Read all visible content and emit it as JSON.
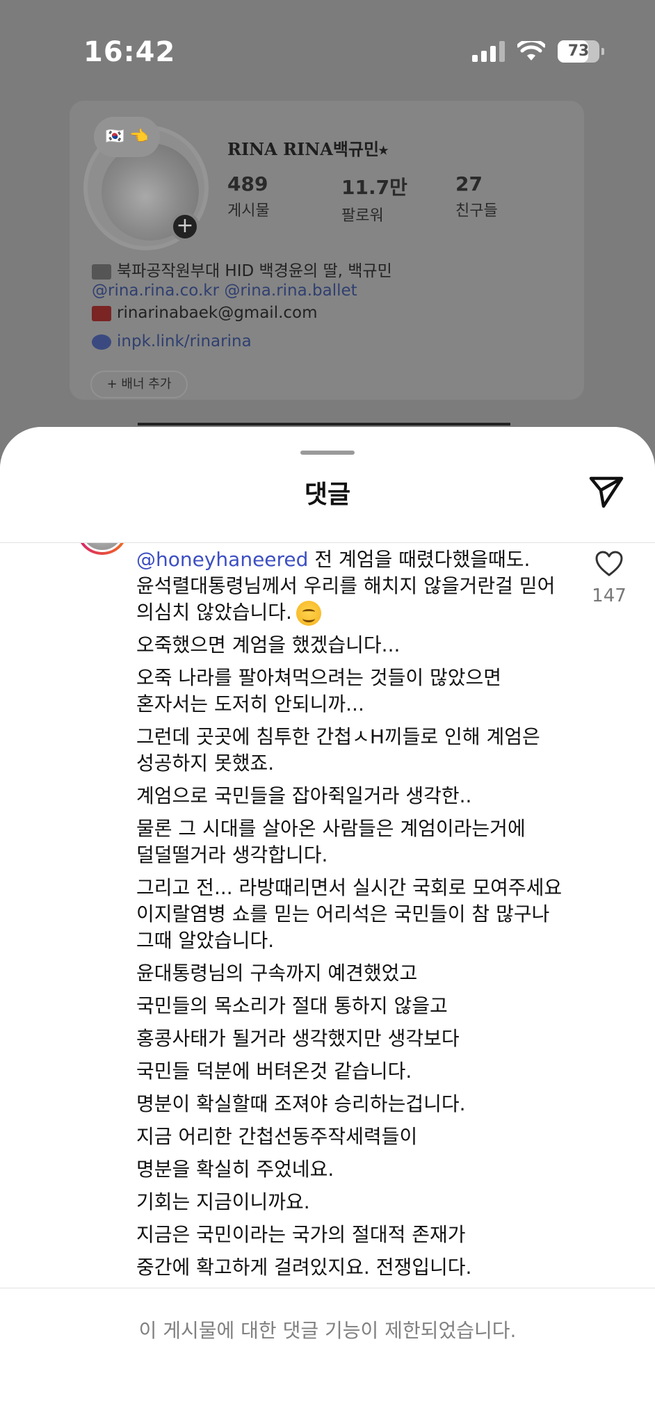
{
  "status_bar": {
    "time": "16:42",
    "battery": "73",
    "icons": [
      "cellular-signal-icon",
      "wifi-icon",
      "battery-icon"
    ]
  },
  "profile": {
    "name": "RINA RINA백규민⭑",
    "avatar_bubble": "🇰🇷 👈",
    "stats": [
      {
        "value": "489",
        "label": "게시물"
      },
      {
        "value": "11.7만",
        "label": "팔로워"
      },
      {
        "value": "27",
        "label": "친구들"
      }
    ],
    "bio_line": "북파공작원부대 HID 백경윤의 딸, 백규민",
    "accounts": "@rina.rina.co.kr @rina.rina.ballet",
    "email": "rinarinabaek@gmail.com",
    "link": "inpk.link/rinarina",
    "banner_button": "+ 배너 추가"
  },
  "sheet": {
    "title": "댓글"
  },
  "comment": {
    "mention": "@honeyhaneered",
    "first_line_rest": " 전 계엄을 때렸다했을때도. 윤석렬대통령님께서 우리를 해치지 않을거란걸 믿어 의심치 않았습니다.",
    "paragraphs": [
      "오죽했으면 계엄을 했겠습니다...",
      "오죽 나라를 팔아쳐먹으려는 것들이 많았으면 혼자서는 도저히 안되니까...",
      "그런데 곳곳에 침투한 간첩ㅅH끼들로 인해 계엄은 성공하지 못했죠.",
      "계엄으로 국민들을 잡아쥑일거라 생각한..",
      "물론 그 시대를 살아온 사람들은 계엄이라는거에 덜덜떨거라 생각합니다.",
      "그리고 전... 라방때리면서 실시간 국회로 모여주세요 이지랄염병 쇼를 믿는 어리석은 국민들이 참 많구나 그때 알았습니다.",
      "윤대통령님의 구속까지 예견했었고",
      "국민들의 목소리가 절대 통하지 않을고",
      "홍콩사태가 될거라 생각했지만 생각보다",
      "국민들 덕분에 버텨온것 같습니다.",
      "명분이 확실할때 조져야 승리하는겁니다.",
      "지금 어리한 간첩선동주작세력들이",
      "명분을 확실히 주었네요.",
      "기회는 지금이니까요.",
      "지금은 국민이라는 국가의 절대적 존재가",
      "중간에 확고하게 걸려있지요. 전쟁입니다."
    ],
    "like_count": "147"
  },
  "footer": {
    "notice": "이 게시물에 대한 댓글 기능이 제한되었습니다."
  },
  "colors": {
    "mention": "#3d4fc2",
    "dim_overlay": "#7b7b7b",
    "muted_text": "#808080"
  }
}
